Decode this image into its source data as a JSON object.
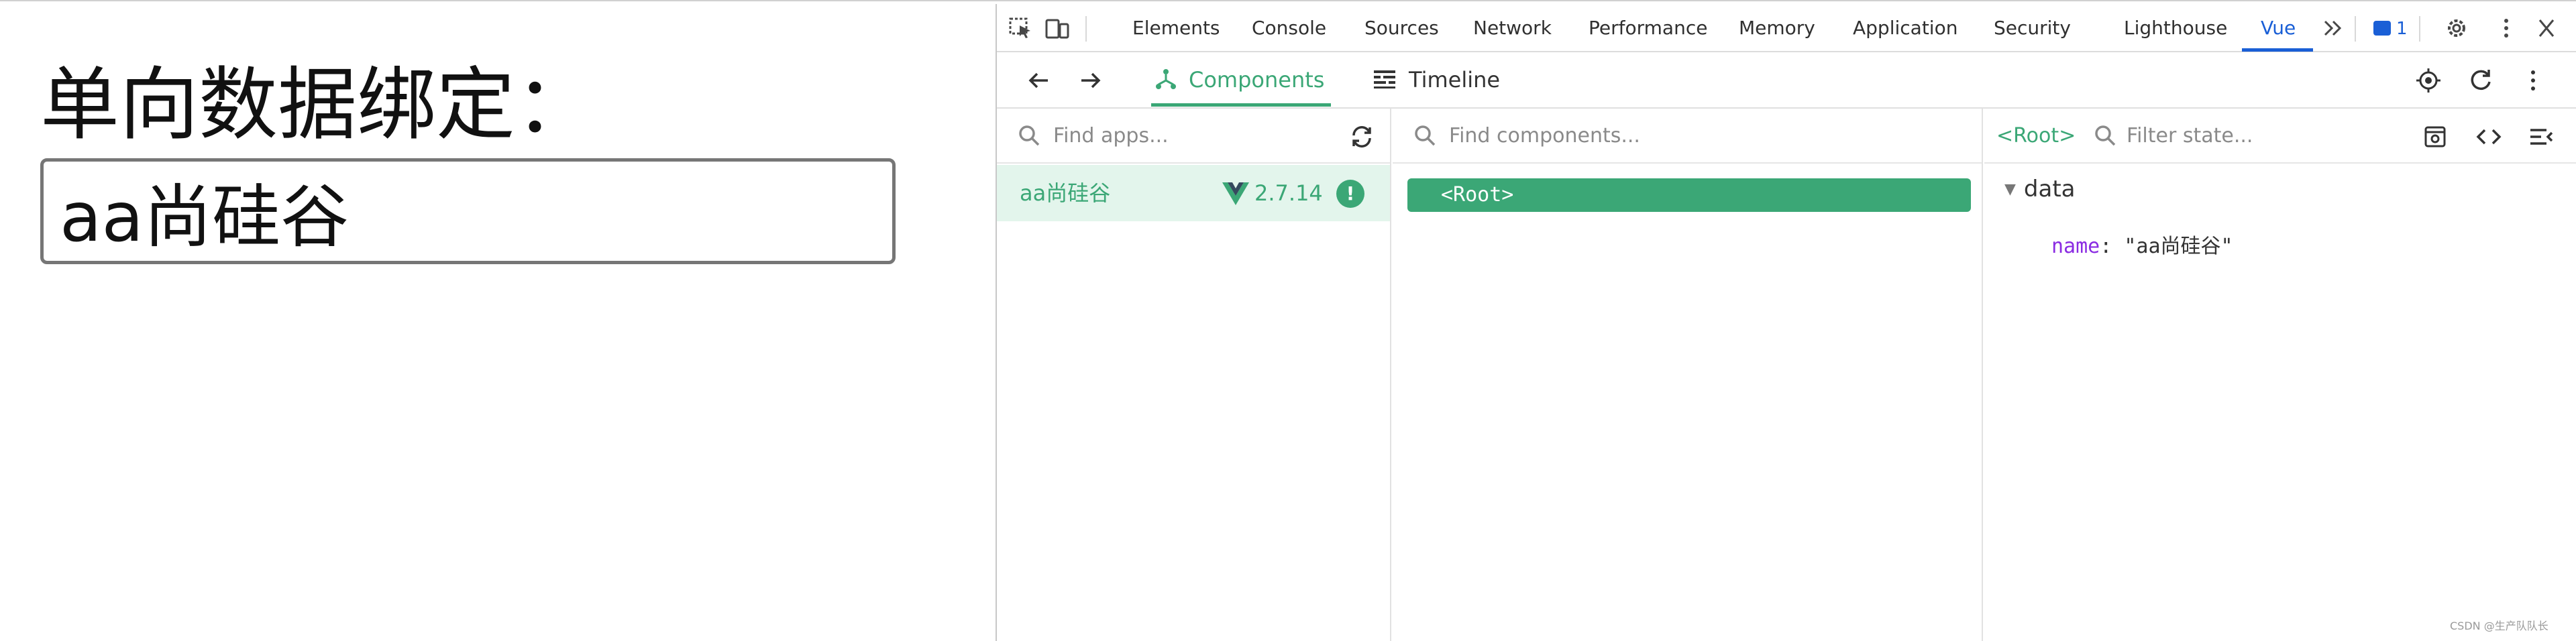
{
  "page": {
    "title": "单向数据绑定：",
    "input_value": "aa尚硅谷"
  },
  "devtools": {
    "tabs": [
      "Elements",
      "Console",
      "Sources",
      "Network",
      "Performance",
      "Memory",
      "Application",
      "Security",
      "Lighthouse",
      "Vue"
    ],
    "active_tab": "Vue",
    "issues_count": "1",
    "accent_color": "#1a5fd6",
    "icons": {
      "inspect": "inspect-element-icon",
      "device": "device-toolbar-icon",
      "more_tabs": "chevron-double-right-icon",
      "issues": "message-icon",
      "settings": "gear-icon",
      "menu": "kebab-menu-icon",
      "close": "close-icon"
    }
  },
  "vue": {
    "accent_color": "#3ba776",
    "tabs": {
      "components": "Components",
      "timeline": "Timeline"
    },
    "apps_search_placeholder": "Find apps...",
    "components_search_placeholder": "Find components...",
    "state_filter_placeholder": "Filter state...",
    "app": {
      "name": "aa尚硅谷",
      "version": "2.7.14"
    },
    "tree": {
      "root": "<Root>"
    },
    "state": {
      "selected": "<Root>",
      "section": "data",
      "props": [
        {
          "key": "name",
          "value": "\"aa尚硅谷\""
        }
      ]
    }
  },
  "watermark": "CSDN @生产队队长"
}
